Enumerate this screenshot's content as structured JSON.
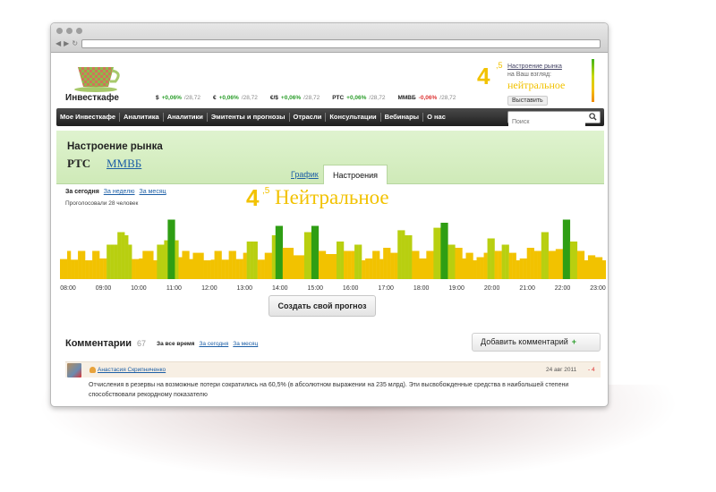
{
  "site": {
    "logo_text": "Инвесткафе"
  },
  "tickers": [
    {
      "sym": "$",
      "change": "+0,06%",
      "value": "/28,72",
      "dir": "up"
    },
    {
      "sym": "€",
      "change": "+0,06%",
      "value": "/28,72",
      "dir": "up"
    },
    {
      "sym": "€/$",
      "change": "+0,06%",
      "value": "/28,72",
      "dir": "up"
    },
    {
      "sym": "РТС",
      "change": "+0,06%",
      "value": "/28,72",
      "dir": "up"
    },
    {
      "sym": "ММВБ",
      "change": "-0,06%",
      "value": "/28,72",
      "dir": "down"
    }
  ],
  "header_mood": {
    "value": "4",
    "fraction": ",5",
    "title": "Настроение рынка",
    "subtitle": "на Ваш взгляд:",
    "word": "нейтральное",
    "button": "Выставить"
  },
  "nav": {
    "items": [
      "Мое Инвесткафе",
      "Аналитика",
      "Аналитики",
      "Эмитенты и прогнозы",
      "Отрасли",
      "Консультации",
      "Вебинары",
      "О нас"
    ],
    "search_placeholder": "Поиск"
  },
  "mood_panel": {
    "heading": "Настроение рынка",
    "index_active": "РТС",
    "index_link": "ММВБ",
    "tabs": [
      "График",
      "Настроения"
    ]
  },
  "periods": {
    "today": "За сегодня",
    "week": "За неделю",
    "month": "За месяц"
  },
  "votes_text": "Проголосовали 28 человек",
  "chart_value": {
    "value": "4",
    "fraction": ",5",
    "word": "Нейтральное"
  },
  "chart_data": {
    "type": "bar",
    "x_labels": [
      "08:00",
      "09:00",
      "10:00",
      "11:00",
      "12:00",
      "13:00",
      "14:00",
      "15:00",
      "16:00",
      "17:00",
      "18:00",
      "19:00",
      "20:00",
      "21:00",
      "22:00",
      "23:00"
    ],
    "colors": {
      "low": "#f2c200",
      "mid": "#b8cf10",
      "high": "#2f9e14"
    }
  },
  "create_button": "Создать свой прогноз",
  "comments": {
    "heading": "Комментарии",
    "count": "67",
    "filter_all": "За все время",
    "filter_today": "За сегодня",
    "filter_month": "За месяц",
    "add_button": "Добавить комментарий",
    "items": [
      {
        "user": "Анастасия Скрипниченко",
        "date": "24 авг 2011",
        "score": "- 4",
        "text": "Отчисления в резервы на возможные потери сократились на 60,5% (в абсолютном выражении на 235 млрд). Эти высвобожденные средства в наибольшей степени способствовали рекордному показателю"
      }
    ]
  }
}
